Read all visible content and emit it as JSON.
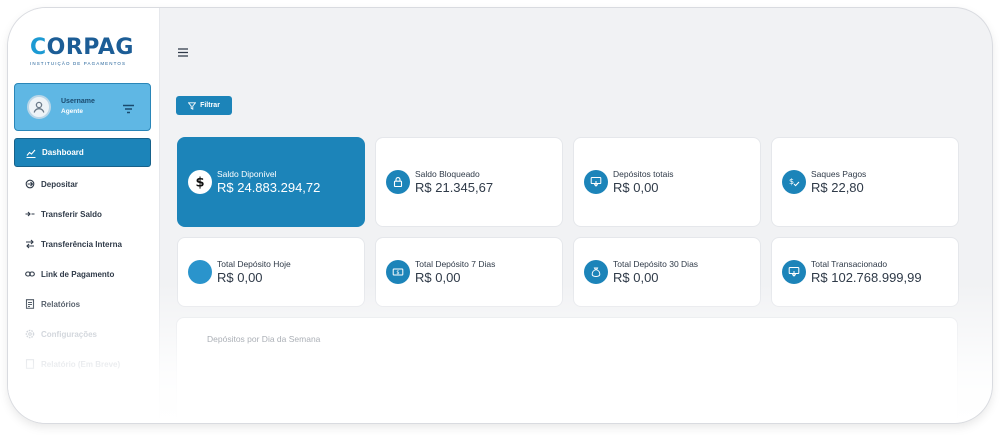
{
  "brand": {
    "name_left": "C",
    "name_right": "ORPAG",
    "tagline": "INSTITUIÇÃO DE PAGAMENTOS"
  },
  "user": {
    "name": "Username",
    "role": "Agente"
  },
  "nav": [
    {
      "label": "Dashboard",
      "icon": "chart-icon",
      "active": true
    },
    {
      "label": "Depositar",
      "icon": "deposit-icon"
    },
    {
      "label": "Transferir Saldo",
      "icon": "transfer-icon"
    },
    {
      "label": "Transferência Interna",
      "icon": "internal-transfer-icon"
    },
    {
      "label": "Link de Pagamento",
      "icon": "link-icon"
    },
    {
      "label": "Relatórios",
      "icon": "report-icon"
    },
    {
      "label": "Configurações",
      "icon": "gear-icon"
    },
    {
      "label": "Relatório (Em Breve)",
      "icon": "report-icon"
    }
  ],
  "toolbar": {
    "filter_label": "Filtrar"
  },
  "cards": [
    {
      "label": "Saldo Diponível",
      "value": "R$ 24.883.294,72",
      "icon": "dollar-icon"
    },
    {
      "label": "Saldo Bloqueado",
      "value": "R$ 21.345,67",
      "icon": "lock-icon"
    },
    {
      "label": "Depósitos totais",
      "value": "R$ 0,00",
      "icon": "deposit-money-icon"
    },
    {
      "label": "Saques Pagos",
      "value": "R$ 22,80",
      "icon": "dollar-check-icon"
    },
    {
      "label": "Total Depósito Hoje",
      "value": "R$ 0,00",
      "icon": "blank-circle-icon"
    },
    {
      "label": "Total Depósito 7 Dias",
      "value": "R$ 0,00",
      "icon": "cash-icon"
    },
    {
      "label": "Total Depósito 30 Dias",
      "value": "R$ 0,00",
      "icon": "money-bag-icon"
    },
    {
      "label": "Total Transacionado",
      "value": "R$ 102.768.999,99",
      "icon": "deposit-money-icon"
    }
  ],
  "chart_panel": {
    "title": "Depósitos por Dia da Semana"
  },
  "colors": {
    "primary": "#1c84b9",
    "brand_dark": "#1c5d96",
    "brand_light": "#1c9ad3",
    "user_card": "#5fb7e4"
  }
}
